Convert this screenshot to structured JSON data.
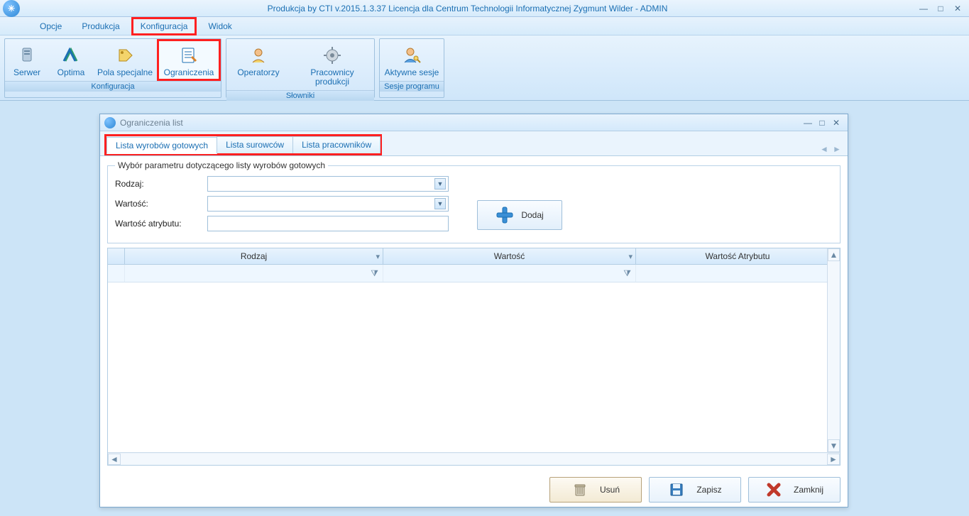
{
  "titlebar": {
    "title": "Produkcja by CTI v.2015.1.3.37 Licencja dla Centrum Technologii Informatycznej Zygmunt Wilder - ADMIN"
  },
  "menu": {
    "items": [
      "Opcje",
      "Produkcja",
      "Konfiguracja",
      "Widok"
    ],
    "highlighted_index": 2
  },
  "ribbon": {
    "groups": [
      {
        "label": "Konfiguracja",
        "buttons": [
          {
            "label": "Serwer",
            "icon": "server-icon"
          },
          {
            "label": "Optima",
            "icon": "optima-icon"
          },
          {
            "label": "Pola specjalne",
            "icon": "tag-icon"
          },
          {
            "label": "Ograniczenia",
            "icon": "list-edit-icon",
            "highlighted": true
          }
        ]
      },
      {
        "label": "Słowniki",
        "buttons": [
          {
            "label": "Operatorzy",
            "icon": "operator-icon"
          },
          {
            "label": "Pracownicy produkcji",
            "icon": "gear-icon"
          }
        ]
      },
      {
        "label": "Sesje programu",
        "buttons": [
          {
            "label": "Aktywne sesje",
            "icon": "user-key-icon"
          }
        ]
      }
    ]
  },
  "subwindow": {
    "title": "Ograniczenia list",
    "tabs": [
      "Lista wyrobów gotowych",
      "Lista surowców",
      "Lista pracowników"
    ],
    "active_tab_index": 0,
    "fieldset_legend": "Wybór parametru dotyczącego listy wyrobów gotowych",
    "form": {
      "rodzaj_label": "Rodzaj:",
      "rodzaj_value": "",
      "wartosc_label": "Wartość:",
      "wartosc_value": "",
      "wartosc_atrybutu_label": "Wartość atrybutu:",
      "wartosc_atrybutu_value": "",
      "dodaj_label": "Dodaj"
    },
    "grid": {
      "columns": [
        "Rodzaj",
        "Wartość",
        "Wartość Atrybutu"
      ]
    },
    "buttons": {
      "usun": "Usuń",
      "zapisz": "Zapisz",
      "zamknij": "Zamknij"
    }
  }
}
